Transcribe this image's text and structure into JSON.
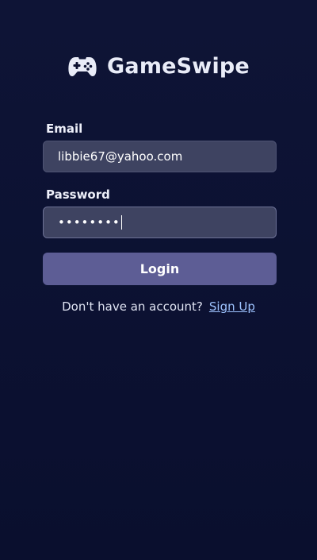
{
  "app": {
    "name": "GameSwipe",
    "logo_icon": "gamepad-icon"
  },
  "form": {
    "email": {
      "label": "Email",
      "value": "libbie67@yahoo.com"
    },
    "password": {
      "label": "Password",
      "masked_value": "••••••••"
    },
    "login_label": "Login"
  },
  "signup": {
    "prompt": "Don't have an account?",
    "link_label": "Sign Up"
  },
  "colors": {
    "background": "#0b1030",
    "input_bg": "#3e4361",
    "button_bg": "#5d5d95",
    "link": "#9ec3ff"
  }
}
